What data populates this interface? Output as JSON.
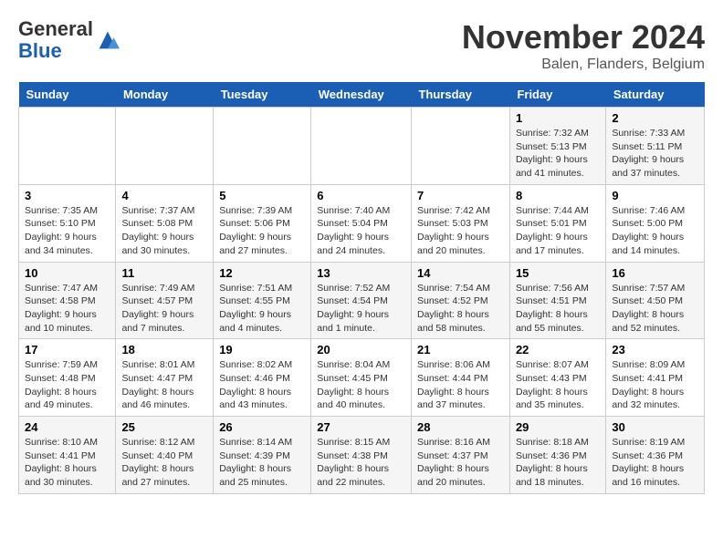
{
  "logo": {
    "general": "General",
    "blue": "Blue"
  },
  "title": "November 2024",
  "location": "Balen, Flanders, Belgium",
  "days_of_week": [
    "Sunday",
    "Monday",
    "Tuesday",
    "Wednesday",
    "Thursday",
    "Friday",
    "Saturday"
  ],
  "weeks": [
    [
      {
        "day": "",
        "info": ""
      },
      {
        "day": "",
        "info": ""
      },
      {
        "day": "",
        "info": ""
      },
      {
        "day": "",
        "info": ""
      },
      {
        "day": "",
        "info": ""
      },
      {
        "day": "1",
        "info": "Sunrise: 7:32 AM\nSunset: 5:13 PM\nDaylight: 9 hours and 41 minutes."
      },
      {
        "day": "2",
        "info": "Sunrise: 7:33 AM\nSunset: 5:11 PM\nDaylight: 9 hours and 37 minutes."
      }
    ],
    [
      {
        "day": "3",
        "info": "Sunrise: 7:35 AM\nSunset: 5:10 PM\nDaylight: 9 hours and 34 minutes."
      },
      {
        "day": "4",
        "info": "Sunrise: 7:37 AM\nSunset: 5:08 PM\nDaylight: 9 hours and 30 minutes."
      },
      {
        "day": "5",
        "info": "Sunrise: 7:39 AM\nSunset: 5:06 PM\nDaylight: 9 hours and 27 minutes."
      },
      {
        "day": "6",
        "info": "Sunrise: 7:40 AM\nSunset: 5:04 PM\nDaylight: 9 hours and 24 minutes."
      },
      {
        "day": "7",
        "info": "Sunrise: 7:42 AM\nSunset: 5:03 PM\nDaylight: 9 hours and 20 minutes."
      },
      {
        "day": "8",
        "info": "Sunrise: 7:44 AM\nSunset: 5:01 PM\nDaylight: 9 hours and 17 minutes."
      },
      {
        "day": "9",
        "info": "Sunrise: 7:46 AM\nSunset: 5:00 PM\nDaylight: 9 hours and 14 minutes."
      }
    ],
    [
      {
        "day": "10",
        "info": "Sunrise: 7:47 AM\nSunset: 4:58 PM\nDaylight: 9 hours and 10 minutes."
      },
      {
        "day": "11",
        "info": "Sunrise: 7:49 AM\nSunset: 4:57 PM\nDaylight: 9 hours and 7 minutes."
      },
      {
        "day": "12",
        "info": "Sunrise: 7:51 AM\nSunset: 4:55 PM\nDaylight: 9 hours and 4 minutes."
      },
      {
        "day": "13",
        "info": "Sunrise: 7:52 AM\nSunset: 4:54 PM\nDaylight: 9 hours and 1 minute."
      },
      {
        "day": "14",
        "info": "Sunrise: 7:54 AM\nSunset: 4:52 PM\nDaylight: 8 hours and 58 minutes."
      },
      {
        "day": "15",
        "info": "Sunrise: 7:56 AM\nSunset: 4:51 PM\nDaylight: 8 hours and 55 minutes."
      },
      {
        "day": "16",
        "info": "Sunrise: 7:57 AM\nSunset: 4:50 PM\nDaylight: 8 hours and 52 minutes."
      }
    ],
    [
      {
        "day": "17",
        "info": "Sunrise: 7:59 AM\nSunset: 4:48 PM\nDaylight: 8 hours and 49 minutes."
      },
      {
        "day": "18",
        "info": "Sunrise: 8:01 AM\nSunset: 4:47 PM\nDaylight: 8 hours and 46 minutes."
      },
      {
        "day": "19",
        "info": "Sunrise: 8:02 AM\nSunset: 4:46 PM\nDaylight: 8 hours and 43 minutes."
      },
      {
        "day": "20",
        "info": "Sunrise: 8:04 AM\nSunset: 4:45 PM\nDaylight: 8 hours and 40 minutes."
      },
      {
        "day": "21",
        "info": "Sunrise: 8:06 AM\nSunset: 4:44 PM\nDaylight: 8 hours and 37 minutes."
      },
      {
        "day": "22",
        "info": "Sunrise: 8:07 AM\nSunset: 4:43 PM\nDaylight: 8 hours and 35 minutes."
      },
      {
        "day": "23",
        "info": "Sunrise: 8:09 AM\nSunset: 4:41 PM\nDaylight: 8 hours and 32 minutes."
      }
    ],
    [
      {
        "day": "24",
        "info": "Sunrise: 8:10 AM\nSunset: 4:41 PM\nDaylight: 8 hours and 30 minutes."
      },
      {
        "day": "25",
        "info": "Sunrise: 8:12 AM\nSunset: 4:40 PM\nDaylight: 8 hours and 27 minutes."
      },
      {
        "day": "26",
        "info": "Sunrise: 8:14 AM\nSunset: 4:39 PM\nDaylight: 8 hours and 25 minutes."
      },
      {
        "day": "27",
        "info": "Sunrise: 8:15 AM\nSunset: 4:38 PM\nDaylight: 8 hours and 22 minutes."
      },
      {
        "day": "28",
        "info": "Sunrise: 8:16 AM\nSunset: 4:37 PM\nDaylight: 8 hours and 20 minutes."
      },
      {
        "day": "29",
        "info": "Sunrise: 8:18 AM\nSunset: 4:36 PM\nDaylight: 8 hours and 18 minutes."
      },
      {
        "day": "30",
        "info": "Sunrise: 8:19 AM\nSunset: 4:36 PM\nDaylight: 8 hours and 16 minutes."
      }
    ]
  ]
}
